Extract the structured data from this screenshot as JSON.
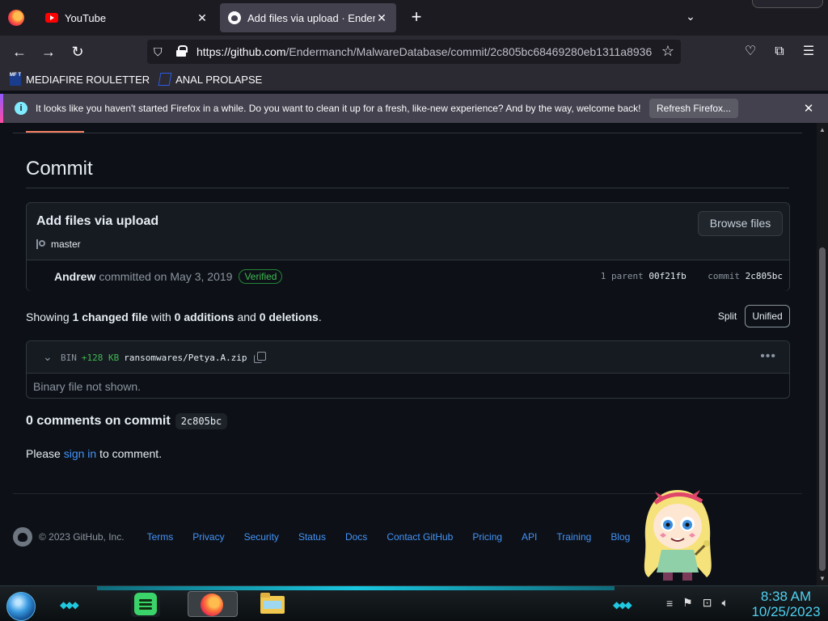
{
  "browser": {
    "tabs": [
      {
        "title": "YouTube",
        "icon": "youtube-icon",
        "active": false
      },
      {
        "title": "Add files via upload · Endermanch/MalwareDatabase",
        "icon": "github-icon",
        "active": true
      }
    ],
    "url_host": "https://github.com",
    "url_path": "/Endermanch/MalwareDatabase/commit/2c805bc68469280eb1311a8936",
    "bookmarks": [
      {
        "label": "MEDIAFIRE ROULETTER",
        "icon_text": "MF T"
      },
      {
        "label": "ANAL PROLAPSE"
      }
    ],
    "notice": {
      "text": "It looks like you haven't started Firefox in a while. Do you want to clean it up for a fresh, like-new experience? And by the way, welcome back!",
      "button": "Refresh Firefox..."
    }
  },
  "page": {
    "heading": "Commit",
    "commit": {
      "title": "Add files via upload",
      "branch": "master",
      "browse_label": "Browse files",
      "author": "Andrew",
      "committed_text": "committed on",
      "date": "May 3, 2019",
      "verified": "Verified",
      "parent_label": "1 parent",
      "parent_sha": "00f21fb",
      "commit_label": "commit",
      "commit_sha": "2c805bc"
    },
    "summary": {
      "prefix": "Showing",
      "changed": "1 changed file",
      "with": "with",
      "additions": "0 additions",
      "and": "and",
      "deletions": "0 deletions",
      "end": "."
    },
    "view_toggle": {
      "split": "Split",
      "unified": "Unified"
    },
    "file": {
      "type": "BIN",
      "delta": "+128 KB",
      "path": "ransomwares/Petya.A.zip",
      "body": "Binary file not shown."
    },
    "comments": {
      "title": "0 comments on commit",
      "sha": "2c805bc",
      "please": "Please",
      "signin": "sign in",
      "suffix": "to comment."
    },
    "footer": {
      "copyright": "© 2023 GitHub, Inc.",
      "links": [
        "Terms",
        "Privacy",
        "Security",
        "Status",
        "Docs",
        "Contact GitHub",
        "Pricing",
        "API",
        "Training",
        "Blog"
      ]
    }
  },
  "taskbar": {
    "apps": [
      "spotify-icon",
      "firefox-icon",
      "file-explorer-icon"
    ],
    "time": "8:38 AM",
    "date": "10/25/2023"
  },
  "colors": {
    "link": "#4493f8",
    "verified": "#3fb950",
    "addition": "#3fb950",
    "clock": "#4fd0f0"
  }
}
